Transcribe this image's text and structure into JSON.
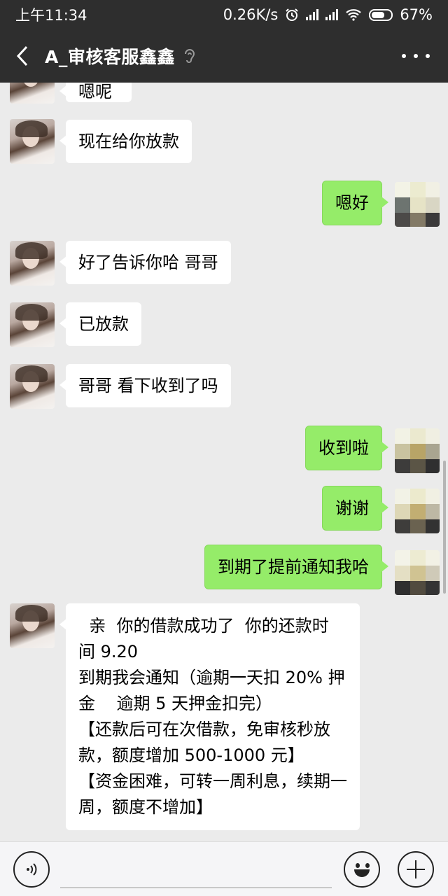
{
  "status_bar": {
    "time": "上午11:34",
    "network_speed": "0.26K/s",
    "battery": "67%",
    "battery_level": 0.67,
    "icons": [
      "alarm-icon",
      "signal-icon",
      "signal-icon",
      "wifi-icon",
      "battery-icon"
    ]
  },
  "header": {
    "title": "A_审核客服鑫鑫",
    "icons": [
      "back-icon",
      "ear-icon",
      "more-icon"
    ]
  },
  "messages": [
    {
      "side": "left",
      "text": "嗯呢"
    },
    {
      "side": "left",
      "text": "现在给你放款"
    },
    {
      "side": "right",
      "text": "嗯好"
    },
    {
      "side": "left",
      "text": "好了告诉你哈  哥哥"
    },
    {
      "side": "left",
      "text": "已放款"
    },
    {
      "side": "left",
      "text": "哥哥 看下收到了吗"
    },
    {
      "side": "right",
      "text": "收到啦"
    },
    {
      "side": "right",
      "text": "谢谢"
    },
    {
      "side": "right",
      "text": "到期了提前通知我哈"
    },
    {
      "side": "left",
      "lines": [
        "  亲  你的借款成功了  你的还款时",
        "间 9.20",
        "到期我会通知（逾期一天扣 20% 押",
        "金    逾期 5 天押金扣完）",
        "【还款后可在次借款，免审核秒放",
        "款，额度增加 500-1000 元】",
        "【资金困难，可转一周利息，续期一",
        "周，额度不增加】"
      ]
    }
  ],
  "input_bar": {
    "icons": [
      "voice-icon",
      "emoji-icon",
      "plus-icon"
    ],
    "value": ""
  },
  "colors": {
    "header_bg": "#2e2e2e",
    "chat_bg": "#ebebeb",
    "sent_bubble": "#95ec69",
    "received_bubble": "#ffffff"
  }
}
